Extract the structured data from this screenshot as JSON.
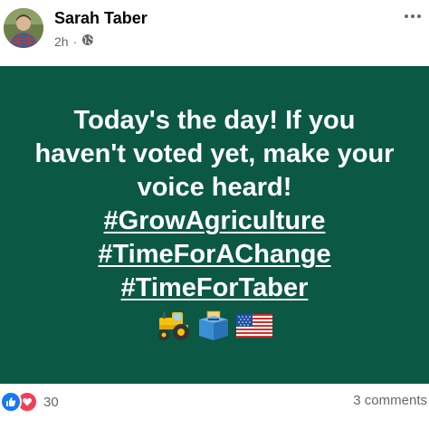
{
  "post": {
    "author": "Sarah Taber",
    "time": "2h",
    "separator": "·",
    "privacy_icon": "globe-icon",
    "card": {
      "background_color": "#0b5844",
      "text_color": "#ffffff",
      "lines": [
        "Today's the day! If you",
        "haven't voted yet, make your",
        "voice heard!",
        "#GrowAgriculture",
        "#TimeForAChange",
        "#TimeForTaber"
      ],
      "emojis": [
        "tractor-icon",
        "ballot-box-icon",
        "us-flag-icon"
      ]
    },
    "reactions": {
      "icons": [
        "like-icon",
        "love-icon"
      ],
      "count": "30"
    },
    "comments": "3 comments",
    "colors": {
      "like": "#1877f2",
      "love": "#f33e58",
      "secondary_text": "#65676b"
    }
  }
}
